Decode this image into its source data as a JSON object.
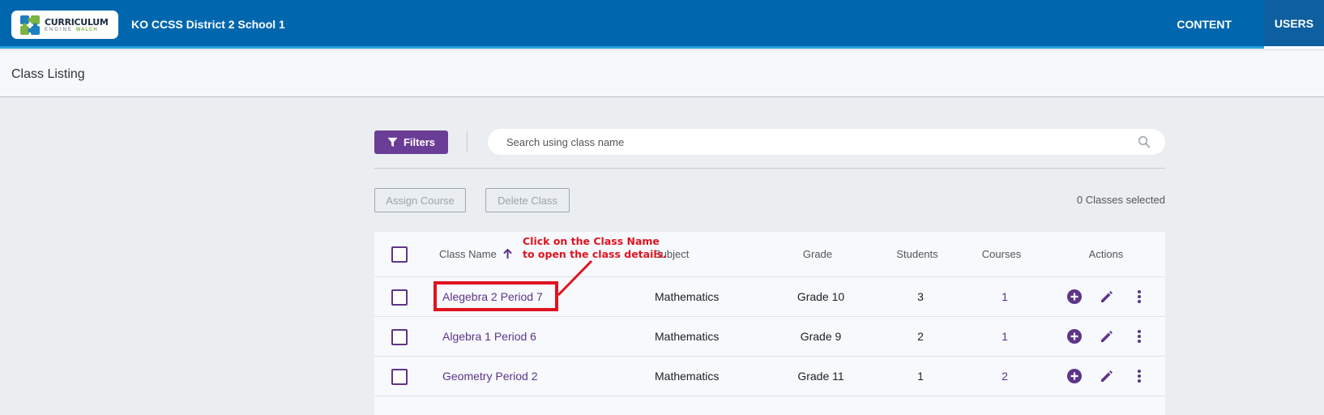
{
  "header": {
    "logo": {
      "main": "CURRICULUM",
      "sub": "ENGINE",
      "sub_brand": "WALCH"
    },
    "org_name": "KO CCSS District 2 School 1",
    "nav": [
      {
        "label": "CONTENT"
      },
      {
        "label": "USERS",
        "active": true
      }
    ]
  },
  "page": {
    "title": "Class Listing"
  },
  "toolbar": {
    "filters_label": "Filters",
    "search_placeholder": "Search using class name",
    "assign_course_label": "Assign Course",
    "delete_class_label": "Delete Class",
    "selected_count": "0 Classes selected"
  },
  "table": {
    "columns": {
      "class_name": "Class Name",
      "subject": "Subject",
      "grade": "Grade",
      "students": "Students",
      "courses": "Courses",
      "actions": "Actions"
    },
    "sort": {
      "column": "class_name",
      "direction": "ascending"
    },
    "rows": [
      {
        "class_name": "Alegebra 2 Period 7",
        "subject": "Mathematics",
        "grade": "Grade 10",
        "students": "3",
        "courses": "1"
      },
      {
        "class_name": "Algebra 1 Period 6",
        "subject": "Mathematics",
        "grade": "Grade 9",
        "students": "2",
        "courses": "1"
      },
      {
        "class_name": "Geometry Period 2",
        "subject": "Mathematics",
        "grade": "Grade 11",
        "students": "1",
        "courses": "2"
      }
    ]
  },
  "annotation": {
    "line1": "Click on the Class Name",
    "line2": "to open the class details."
  },
  "colors": {
    "header_bg": "#0067ae",
    "accent_purple": "#6a3d96",
    "annotation_red": "#e0131f"
  }
}
